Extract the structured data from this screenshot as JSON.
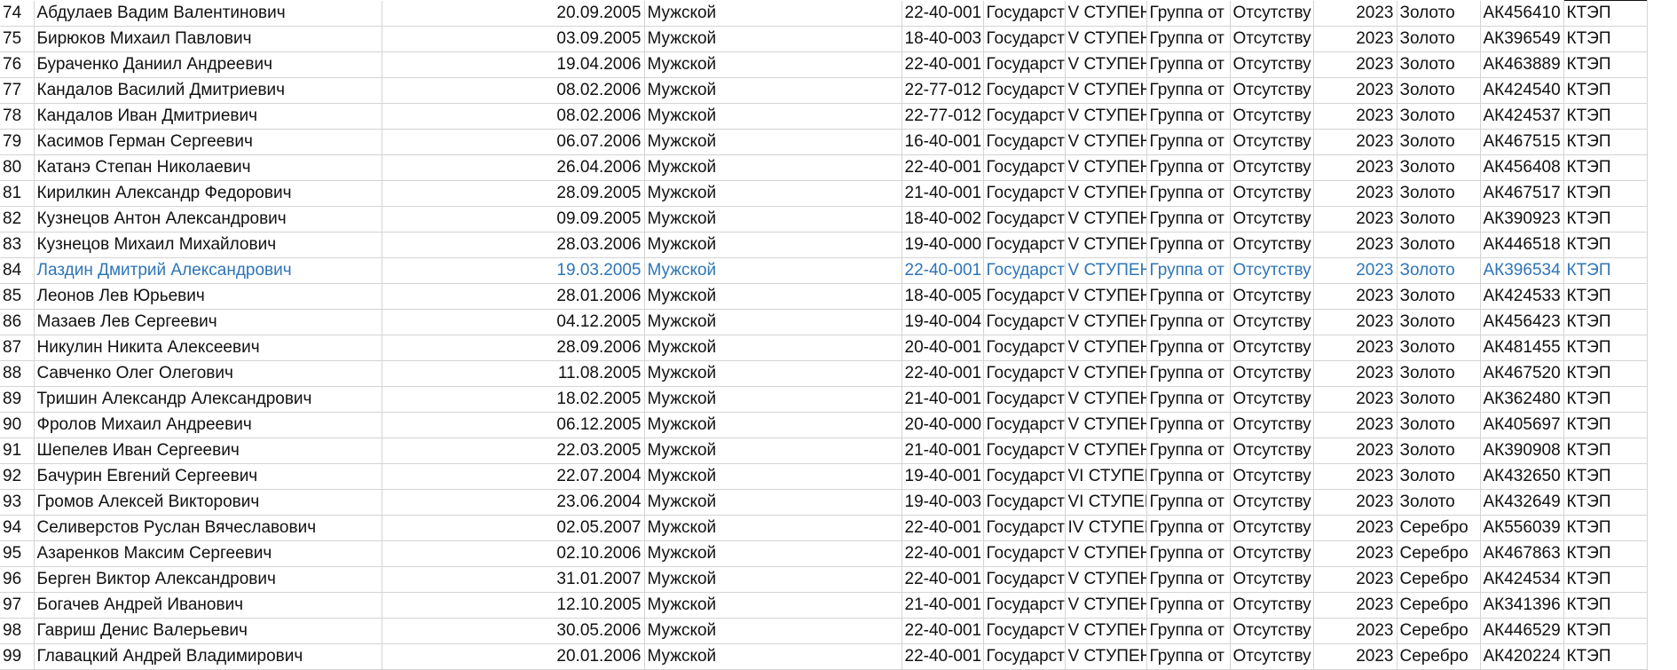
{
  "rows": [
    {
      "n": "74",
      "name": "Абдулаев Вадим Валентинович",
      "dob": "20.09.2005",
      "sex": "Мужской",
      "code": "22-40-001",
      "org": "Государст",
      "stage": "V СТУПЕН",
      "group": "Группа от",
      "status": "Отсутству",
      "year": "2023",
      "medal": "Золото",
      "cert": "АК456410",
      "src": "КТЭП"
    },
    {
      "n": "75",
      "name": "Бирюков Михаил Павлович",
      "dob": "03.09.2005",
      "sex": "Мужской",
      "code": "18-40-003",
      "org": "Государст",
      "stage": "V СТУПЕН",
      "group": "Группа от",
      "status": "Отсутству",
      "year": "2023",
      "medal": "Золото",
      "cert": "АК396549",
      "src": "КТЭП"
    },
    {
      "n": "76",
      "name": "Бураченко Даниил Андреевич",
      "dob": "19.04.2006",
      "sex": "Мужской",
      "code": "22-40-001",
      "org": "Государст",
      "stage": "V СТУПЕН",
      "group": "Группа от",
      "status": "Отсутству",
      "year": "2023",
      "medal": "Золото",
      "cert": "АК463889",
      "src": "КТЭП"
    },
    {
      "n": "77",
      "name": "Кандалов Василий Дмитриевич",
      "dob": "08.02.2006",
      "sex": "Мужской",
      "code": "22-77-012",
      "org": "Государст",
      "stage": "V СТУПЕН",
      "group": "Группа от",
      "status": "Отсутству",
      "year": "2023",
      "medal": "Золото",
      "cert": "АК424540",
      "src": "КТЭП"
    },
    {
      "n": "78",
      "name": "Кандалов Иван Дмитриевич",
      "dob": "08.02.2006",
      "sex": "Мужской",
      "code": "22-77-012",
      "org": "Государст",
      "stage": "V СТУПЕН",
      "group": "Группа от",
      "status": "Отсутству",
      "year": "2023",
      "medal": "Золото",
      "cert": "АК424537",
      "src": "КТЭП"
    },
    {
      "n": "79",
      "name": "Касимов Герман Сергеевич",
      "dob": "06.07.2006",
      "sex": "Мужской",
      "code": "16-40-001",
      "org": "Государст",
      "stage": "V СТУПЕН",
      "group": "Группа от",
      "status": "Отсутству",
      "year": "2023",
      "medal": "Золото",
      "cert": "АК467515",
      "src": "КТЭП"
    },
    {
      "n": "80",
      "name": "Катанэ Степан Николаевич",
      "dob": "26.04.2006",
      "sex": "Мужской",
      "code": "22-40-001",
      "org": "Государст",
      "stage": "V СТУПЕН",
      "group": "Группа от",
      "status": "Отсутству",
      "year": "2023",
      "medal": "Золото",
      "cert": "АК456408",
      "src": "КТЭП"
    },
    {
      "n": "81",
      "name": "Кирилкин Александр Федорович",
      "dob": "28.09.2005",
      "sex": "Мужской",
      "code": "21-40-001",
      "org": "Государст",
      "stage": "V СТУПЕН",
      "group": "Группа от",
      "status": "Отсутству",
      "year": "2023",
      "medal": "Золото",
      "cert": "АК467517",
      "src": "КТЭП"
    },
    {
      "n": "82",
      "name": "Кузнецов Антон Александрович",
      "dob": "09.09.2005",
      "sex": "Мужской",
      "code": "18-40-002",
      "org": "Государст",
      "stage": "V СТУПЕН",
      "group": "Группа от",
      "status": "Отсутству",
      "year": "2023",
      "medal": "Золото",
      "cert": "АК390923",
      "src": "КТЭП"
    },
    {
      "n": "83",
      "name": "Кузнецов Михаил Михайлович",
      "dob": "28.03.2006",
      "sex": "Мужской",
      "code": "19-40-000",
      "org": "Государст",
      "stage": "V СТУПЕН",
      "group": "Группа от",
      "status": "Отсутству",
      "year": "2023",
      "medal": "Золото",
      "cert": "АК446518",
      "src": "КТЭП"
    },
    {
      "n": "84",
      "name": "Лаздин Дмитрий Александрович",
      "dob": "19.03.2005",
      "sex": "Мужской",
      "code": "22-40-001",
      "org": "Государст",
      "stage": "V СТУПЕН",
      "group": "Группа от",
      "status": "Отсутству",
      "year": "2023",
      "medal": "Золото",
      "cert": "АК396534",
      "src": "КТЭП",
      "highlight": true
    },
    {
      "n": "85",
      "name": "Леонов Лев Юрьевич",
      "dob": "28.01.2006",
      "sex": "Мужской",
      "code": "18-40-005",
      "org": "Государст",
      "stage": "V СТУПЕН",
      "group": "Группа от",
      "status": "Отсутству",
      "year": "2023",
      "medal": "Золото",
      "cert": "АК424533",
      "src": "КТЭП"
    },
    {
      "n": "86",
      "name": "Мазаев Лев Сергеевич",
      "dob": "04.12.2005",
      "sex": "Мужской",
      "code": "19-40-004",
      "org": "Государст",
      "stage": "V СТУПЕН",
      "group": "Группа от",
      "status": "Отсутству",
      "year": "2023",
      "medal": "Золото",
      "cert": "АК456423",
      "src": "КТЭП"
    },
    {
      "n": "87",
      "name": "Никулин Никита Алексеевич",
      "dob": "28.09.2006",
      "sex": "Мужской",
      "code": "20-40-001",
      "org": "Государст",
      "stage": "V СТУПЕН",
      "group": "Группа от",
      "status": "Отсутству",
      "year": "2023",
      "medal": "Золото",
      "cert": "АК481455",
      "src": "КТЭП"
    },
    {
      "n": "88",
      "name": "Савченко Олег Олегович",
      "dob": "11.08.2005",
      "sex": "Мужской",
      "code": "22-40-001",
      "org": "Государст",
      "stage": "V СТУПЕН",
      "group": "Группа от",
      "status": "Отсутству",
      "year": "2023",
      "medal": "Золото",
      "cert": "АК467520",
      "src": "КТЭП"
    },
    {
      "n": "89",
      "name": "Тришин Александр Александрович",
      "dob": "18.02.2005",
      "sex": "Мужской",
      "code": "21-40-001",
      "org": "Государст",
      "stage": "V СТУПЕН",
      "group": "Группа от",
      "status": "Отсутству",
      "year": "2023",
      "medal": "Золото",
      "cert": "АК362480",
      "src": "КТЭП"
    },
    {
      "n": "90",
      "name": "Фролов Михаил Андреевич",
      "dob": "06.12.2005",
      "sex": "Мужской",
      "code": "20-40-000",
      "org": "Государст",
      "stage": "V СТУПЕН",
      "group": "Группа от",
      "status": "Отсутству",
      "year": "2023",
      "medal": "Золото",
      "cert": "АК405697",
      "src": "КТЭП"
    },
    {
      "n": "91",
      "name": "Шепелев Иван Сергеевич",
      "dob": "22.03.2005",
      "sex": "Мужской",
      "code": "21-40-001",
      "org": "Государст",
      "stage": "V СТУПЕН",
      "group": "Группа от",
      "status": "Отсутству",
      "year": "2023",
      "medal": "Золото",
      "cert": "АК390908",
      "src": "КТЭП"
    },
    {
      "n": "92",
      "name": "Бачурин Евгений Сергеевич",
      "dob": "22.07.2004",
      "sex": "Мужской",
      "code": "19-40-001",
      "org": "Государст",
      "stage": "VI СТУПЕН",
      "group": "Группа от",
      "status": "Отсутству",
      "year": "2023",
      "medal": "Золото",
      "cert": "АК432650",
      "src": "КТЭП"
    },
    {
      "n": "93",
      "name": "Громов Алексей Викторович",
      "dob": "23.06.2004",
      "sex": "Мужской",
      "code": "19-40-003",
      "org": "Государст",
      "stage": "VI СТУПЕН",
      "group": "Группа от",
      "status": "Отсутству",
      "year": "2023",
      "medal": "Золото",
      "cert": "АК432649",
      "src": "КТЭП"
    },
    {
      "n": "94",
      "name": "Селиверстов Руслан Вячеславович",
      "dob": "02.05.2007",
      "sex": "Мужской",
      "code": "22-40-001",
      "org": "Государст",
      "stage": "IV СТУПЕН",
      "group": "Группа от",
      "status": "Отсутству",
      "year": "2023",
      "medal": "Серебро",
      "cert": "АК556039",
      "src": "КТЭП"
    },
    {
      "n": "95",
      "name": "Азаренков Максим Сергеевич",
      "dob": "02.10.2006",
      "sex": "Мужской",
      "code": "22-40-001",
      "org": "Государст",
      "stage": "V СТУПЕН",
      "group": "Группа от",
      "status": "Отсутству",
      "year": "2023",
      "medal": "Серебро",
      "cert": "АК467863",
      "src": "КТЭП"
    },
    {
      "n": "96",
      "name": "Берген Виктор Александрович",
      "dob": "31.01.2007",
      "sex": "Мужской",
      "code": "22-40-001",
      "org": "Государст",
      "stage": "V СТУПЕН",
      "group": "Группа от",
      "status": "Отсутству",
      "year": "2023",
      "medal": "Серебро",
      "cert": "АК424534",
      "src": "КТЭП"
    },
    {
      "n": "97",
      "name": "Богачев Андрей Иванович",
      "dob": "12.10.2005",
      "sex": "Мужской",
      "code": "21-40-001",
      "org": "Государст",
      "stage": "V СТУПЕН",
      "group": "Группа от",
      "status": "Отсутству",
      "year": "2023",
      "medal": "Серебро",
      "cert": "АК341396",
      "src": "КТЭП"
    },
    {
      "n": "98",
      "name": "Гавриш Денис Валерьевич",
      "dob": "30.05.2006",
      "sex": "Мужской",
      "code": "22-40-001",
      "org": "Государст",
      "stage": "V СТУПЕН",
      "group": "Группа от",
      "status": "Отсутству",
      "year": "2023",
      "medal": "Серебро",
      "cert": "АК446529",
      "src": "КТЭП"
    },
    {
      "n": "99",
      "name": "Главацкий Андрей Владимирович",
      "dob": "20.01.2006",
      "sex": "Мужской",
      "code": "22-40-001",
      "org": "Государст",
      "stage": "V СТУПЕН",
      "group": "Группа от",
      "status": "Отсутству",
      "year": "2023",
      "medal": "Серебро",
      "cert": "АК420224",
      "src": "КТЭП"
    }
  ],
  "colors": {
    "highlight_text": "#2e75b6",
    "gridline": "#d4d4d4",
    "text": "#111111"
  }
}
